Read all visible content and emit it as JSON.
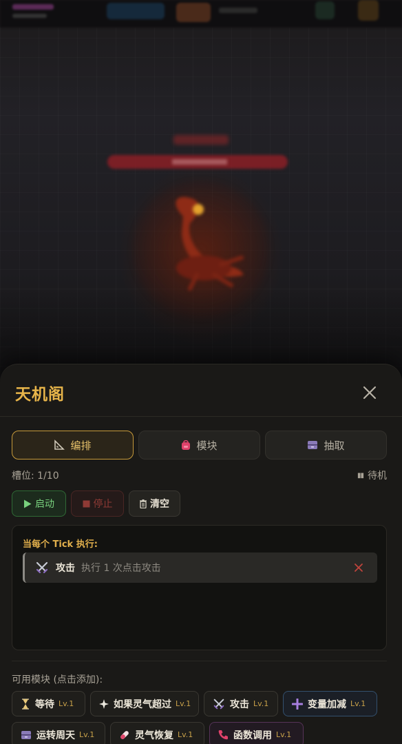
{
  "panel": {
    "title": "天机阁",
    "tabs": [
      {
        "label": "编排",
        "icon": "triangle-ruler-icon",
        "active": true
      },
      {
        "label": "模块",
        "icon": "backpack-icon",
        "active": false
      },
      {
        "label": "抽取",
        "icon": "drawer-icon",
        "active": false
      }
    ],
    "slots_text": "槽位: 1/10",
    "status_text": "待机",
    "controls": {
      "start_label": "启动",
      "stop_label": "停止",
      "clear_label": "清空"
    },
    "editor": {
      "label": "当每个 Tick 执行:",
      "blocks": [
        {
          "name": "攻击",
          "desc": "执行 1 次点击攻击",
          "icon": "crossed-swords-icon"
        }
      ]
    },
    "available_label": "可用模块 (点击添加):",
    "modules": [
      {
        "name": "等待",
        "level": "Lv.1",
        "icon": "hourglass-icon"
      },
      {
        "name": "如果灵气超过",
        "level": "Lv.1",
        "icon": "sparkle-icon"
      },
      {
        "name": "攻击",
        "level": "Lv.1",
        "icon": "crossed-swords-icon"
      },
      {
        "name": "变量加减",
        "level": "Lv.1",
        "icon": "plus-icon"
      },
      {
        "name": "运转周天",
        "level": "Lv.1",
        "icon": "drawer-icon"
      },
      {
        "name": "灵气恢复",
        "level": "Lv.1",
        "icon": "pill-icon"
      },
      {
        "name": "函数调用",
        "level": "Lv.1",
        "icon": "phone-icon"
      }
    ]
  },
  "colors": {
    "accent_gold": "#e8b54a",
    "start_green": "#79d27e",
    "stop_red": "#8f3a35",
    "remove_red": "#c0443c"
  }
}
